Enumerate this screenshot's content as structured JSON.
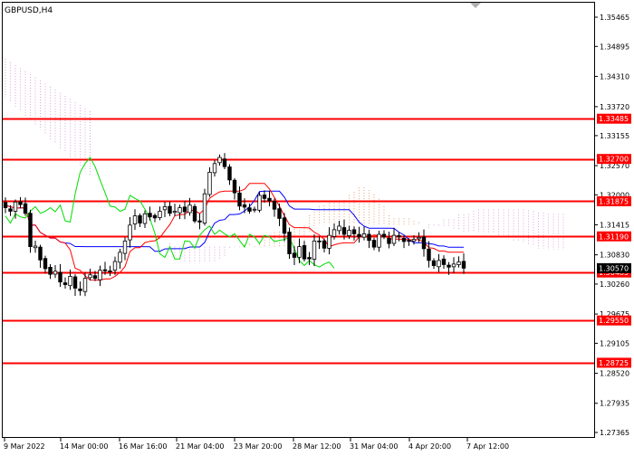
{
  "window": {
    "symbol_label": "GBPUSD,H4"
  },
  "colors": {
    "background": "#ffffff",
    "frame": "#000000",
    "candle": "#000000",
    "level_line": "#ff0000",
    "level_badge": "#ff0000",
    "price_badge": "#000000",
    "tenkan": "#ff0000",
    "kijun": "#0000ff",
    "chikou": "#00dd00",
    "cloud_up": "#e8a070",
    "cloud_down": "#d8a8d8"
  },
  "chart_data": {
    "type": "candlestick",
    "instrument": "GBPUSD",
    "timeframe": "H4",
    "ylim": [
      1.272,
      1.357
    ],
    "price_ticks": [
      1.35465,
      1.34895,
      1.3431,
      1.3372,
      1.33155,
      1.3257,
      1.32,
      1.31415,
      1.3083,
      1.3026,
      1.29675,
      1.29105,
      1.2852,
      1.27935,
      1.27365
    ],
    "price_tick_labels": [
      "1.35465",
      "1.34895",
      "1.34310",
      "1.33720",
      "1.33155",
      "1.32570",
      "1.32000",
      "1.31415",
      "1.30830",
      "1.30260",
      "1.29675",
      "1.29105",
      "1.28520",
      "1.27935",
      "1.27365"
    ],
    "time_labels": [
      "9 Mar 2022",
      "14 Mar 00:00",
      "16 Mar 16:00",
      "21 Mar 04:00",
      "23 Mar 20:00",
      "28 Mar 12:00",
      "31 Mar 04:00",
      "4 Apr 20:00",
      "7 Apr 12:00"
    ],
    "levels": [
      {
        "value": 1.33485,
        "label": "1.33485"
      },
      {
        "value": 1.327,
        "label": "1.32700"
      },
      {
        "value": 1.31875,
        "label": "1.31875"
      },
      {
        "value": 1.3119,
        "label": "1.31190"
      },
      {
        "value": 1.30485,
        "label": "1.30485"
      },
      {
        "value": 1.2955,
        "label": "1.29550"
      },
      {
        "value": 1.28725,
        "label": "1.28725"
      }
    ],
    "current_price": {
      "value": 1.3057,
      "label": "1.30570"
    },
    "close": [
      1.3175,
      1.3168,
      1.3186,
      1.3181,
      1.3164,
      1.3099,
      1.31,
      1.3073,
      1.3056,
      1.3045,
      1.3051,
      1.303,
      1.3025,
      1.3041,
      1.3018,
      1.3013,
      1.3037,
      1.3044,
      1.3037,
      1.3053,
      1.3052,
      1.3051,
      1.307,
      1.3088,
      1.311,
      1.3141,
      1.3159,
      1.3145,
      1.3163,
      1.3157,
      1.3155,
      1.3168,
      1.3177,
      1.3164,
      1.3168,
      1.3175,
      1.3167,
      1.318,
      1.3149,
      1.3147,
      1.3202,
      1.3244,
      1.3261,
      1.3273,
      1.3255,
      1.3229,
      1.3204,
      1.3178,
      1.3176,
      1.3168,
      1.3172,
      1.3199,
      1.3193,
      1.3188,
      1.3172,
      1.3154,
      1.3125,
      1.3085,
      1.3078,
      1.3099,
      1.3075,
      1.3075,
      1.311,
      1.3109,
      1.3096,
      1.3121,
      1.3132,
      1.3139,
      1.3123,
      1.3131,
      1.3124,
      1.3118,
      1.3124,
      1.3111,
      1.3098,
      1.3123,
      1.3118,
      1.3105,
      1.3121,
      1.3118,
      1.3109,
      1.3111,
      1.3113,
      1.3117,
      1.3095,
      1.3072,
      1.3062,
      1.3072,
      1.3064,
      1.3059,
      1.3065,
      1.3069,
      1.3057
    ]
  }
}
